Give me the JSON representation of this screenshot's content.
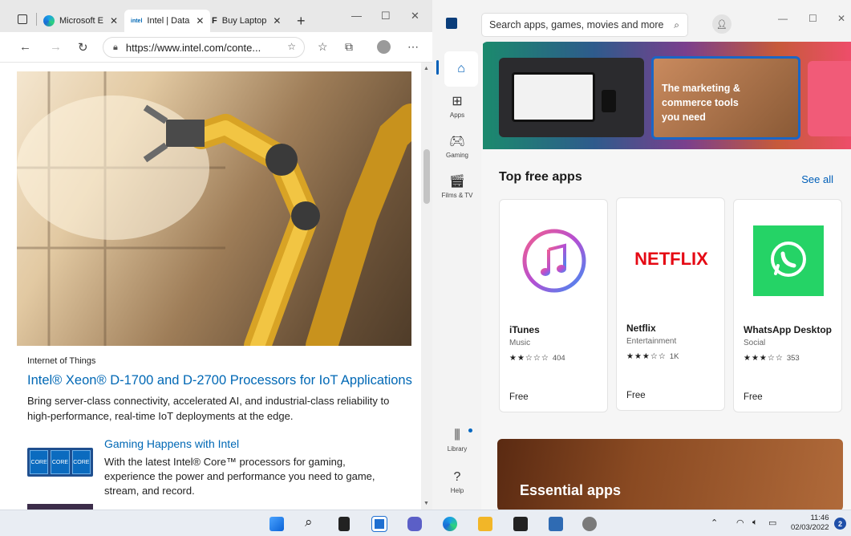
{
  "edge": {
    "tabs": [
      {
        "label": "Microsoft E",
        "favicon": "edge-logo"
      },
      {
        "label": "Intel | Data",
        "favicon": "intel-logo"
      },
      {
        "label": "Buy Laptop",
        "favicon": "store-logo"
      }
    ],
    "new_tab": "+",
    "url": "https://www.intel.com/conte...",
    "article": {
      "category": "Internet of Things",
      "title": "Intel® Xeon® D-1700 and D-2700 Processors for IoT Applications",
      "description": "Bring server-class connectivity, accelerated AI, and industrial-class reliability to high-performance, real-time IoT deployments at the edge."
    },
    "promo": {
      "title": "Gaming Happens with Intel",
      "description": "With the latest Intel® Core™ processors for gaming, experience the power and performance you need to game, stream, and record.",
      "chip_label": "CORE"
    }
  },
  "store": {
    "search_placeholder": "Search apps, games, movies and more",
    "nav": [
      {
        "label": "",
        "icon": "home-icon"
      },
      {
        "label": "Apps",
        "icon": "apps-icon"
      },
      {
        "label": "Gaming",
        "icon": "gaming-icon"
      },
      {
        "label": "Films & TV",
        "icon": "films-icon"
      },
      {
        "label": "Library",
        "icon": "library-icon"
      },
      {
        "label": "Help",
        "icon": "help-icon"
      }
    ],
    "banner_text": "The marketing & commerce tools you need",
    "section_title": "Top free apps",
    "see_all": "See all",
    "apps": [
      {
        "name": "iTunes",
        "category": "Music",
        "rating": 2,
        "stars": "★★☆☆☆",
        "count": "404",
        "price": "Free",
        "brand_color": "#e94b8a"
      },
      {
        "name": "Netflix",
        "category": "Entertainment",
        "rating": 3,
        "stars": "★★★☆☆",
        "count": "1K",
        "price": "Free",
        "brand_color": "#e50914",
        "logo_text": "NETFLIX"
      },
      {
        "name": "WhatsApp Desktop",
        "category": "Social",
        "rating": 3,
        "stars": "★★★☆☆",
        "count": "353",
        "price": "Free",
        "brand_color": "#25d366"
      }
    ],
    "essential_title": "Essential apps"
  },
  "taskbar": {
    "time": "11:46",
    "date": "02/03/2022",
    "notification_count": "2"
  }
}
